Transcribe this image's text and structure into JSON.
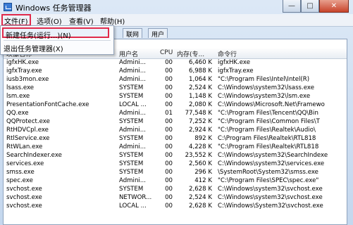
{
  "window": {
    "title": "Windows 任务管理器",
    "buttons": {
      "minimize": "—",
      "maximize": "□",
      "close": "✕"
    }
  },
  "menubar": [
    {
      "label": "文件(F)"
    },
    {
      "label": "选项(O)"
    },
    {
      "label": "查看(V)"
    },
    {
      "label": "帮助(H)"
    }
  ],
  "file_menu": {
    "items": [
      {
        "label": "新建任务(运行...)(N)"
      },
      {
        "label": "退出任务管理器(X)"
      }
    ]
  },
  "tabs": [
    {
      "label": "联网"
    },
    {
      "label": "用户"
    }
  ],
  "table": {
    "columns": {
      "name": "映像名称",
      "user": "用户名",
      "cpu": "CPU",
      "mem": "内存(专...",
      "cmd": "命令行"
    },
    "rows": [
      {
        "name": "igfxHK.exe",
        "user": "Admini...",
        "cpu": "00",
        "mem": "6,460 K",
        "cmd": "igfxHK.exe"
      },
      {
        "name": "igfxTray.exe",
        "user": "Admini...",
        "cpu": "00",
        "mem": "6,988 K",
        "cmd": "igfxTray.exe"
      },
      {
        "name": "iusb3mon.exe",
        "user": "Admini...",
        "cpu": "00",
        "mem": "1,064 K",
        "cmd": "\"C:\\Program Files\\Intel\\Intel(R)"
      },
      {
        "name": "lsass.exe",
        "user": "SYSTEM",
        "cpu": "00",
        "mem": "2,524 K",
        "cmd": "C:\\Windows\\system32\\lsass.exe"
      },
      {
        "name": "lsm.exe",
        "user": "SYSTEM",
        "cpu": "00",
        "mem": "1,148 K",
        "cmd": "C:\\Windows\\system32\\lsm.exe"
      },
      {
        "name": "PresentationFontCache.exe",
        "user": "LOCAL ...",
        "cpu": "00",
        "mem": "2,080 K",
        "cmd": "C:\\Windows\\Microsoft.Net\\Framewo"
      },
      {
        "name": "QQ.exe",
        "user": "Admini...",
        "cpu": "01",
        "mem": "77,548 K",
        "cmd": "\"C:\\Program Files\\Tencent\\QQ\\Bin"
      },
      {
        "name": "QQProtect.exe",
        "user": "SYSTEM",
        "cpu": "00",
        "mem": "7,252 K",
        "cmd": "\"C:\\Program Files\\Common Files\\T"
      },
      {
        "name": "RtHDVCpl.exe",
        "user": "Admini...",
        "cpu": "00",
        "mem": "2,924 K",
        "cmd": "\"C:\\Program Files\\Realtek\\Audio\\"
      },
      {
        "name": "RtlService.exe",
        "user": "SYSTEM",
        "cpu": "00",
        "mem": "892 K",
        "cmd": "C:\\Program Files\\Realtek\\RTL818"
      },
      {
        "name": "RtWLan.exe",
        "user": "Admini...",
        "cpu": "00",
        "mem": "4,228 K",
        "cmd": "\"C:\\Program Files\\Realtek\\RTL818"
      },
      {
        "name": "SearchIndexer.exe",
        "user": "SYSTEM",
        "cpu": "00",
        "mem": "23,552 K",
        "cmd": "C:\\Windows\\system32\\SearchIndexe"
      },
      {
        "name": "services.exe",
        "user": "SYSTEM",
        "cpu": "00",
        "mem": "2,560 K",
        "cmd": "C:\\Windows\\system32\\services.exe"
      },
      {
        "name": "smss.exe",
        "user": "SYSTEM",
        "cpu": "00",
        "mem": "296 K",
        "cmd": "\\SystemRoot\\System32\\smss.exe"
      },
      {
        "name": "spec.exe",
        "user": "Admini...",
        "cpu": "00",
        "mem": "412 K",
        "cmd": "\"C:\\Program Files\\SPEC\\spec.exe\""
      },
      {
        "name": "svchost.exe",
        "user": "SYSTEM",
        "cpu": "00",
        "mem": "2,628 K",
        "cmd": "C:\\Windows\\system32\\svchost.exe"
      },
      {
        "name": "svchost.exe",
        "user": "NETWOR...",
        "cpu": "00",
        "mem": "2,524 K",
        "cmd": "C:\\Windows\\system32\\svchost.exe"
      },
      {
        "name": "svchost.exe",
        "user": "LOCAL ...",
        "cpu": "00",
        "mem": "2,628 K",
        "cmd": "C:\\Windows\\System32\\svchost.exe"
      }
    ]
  },
  "colors": {
    "highlight": "#e0294a",
    "close_button": "#c7432a"
  }
}
